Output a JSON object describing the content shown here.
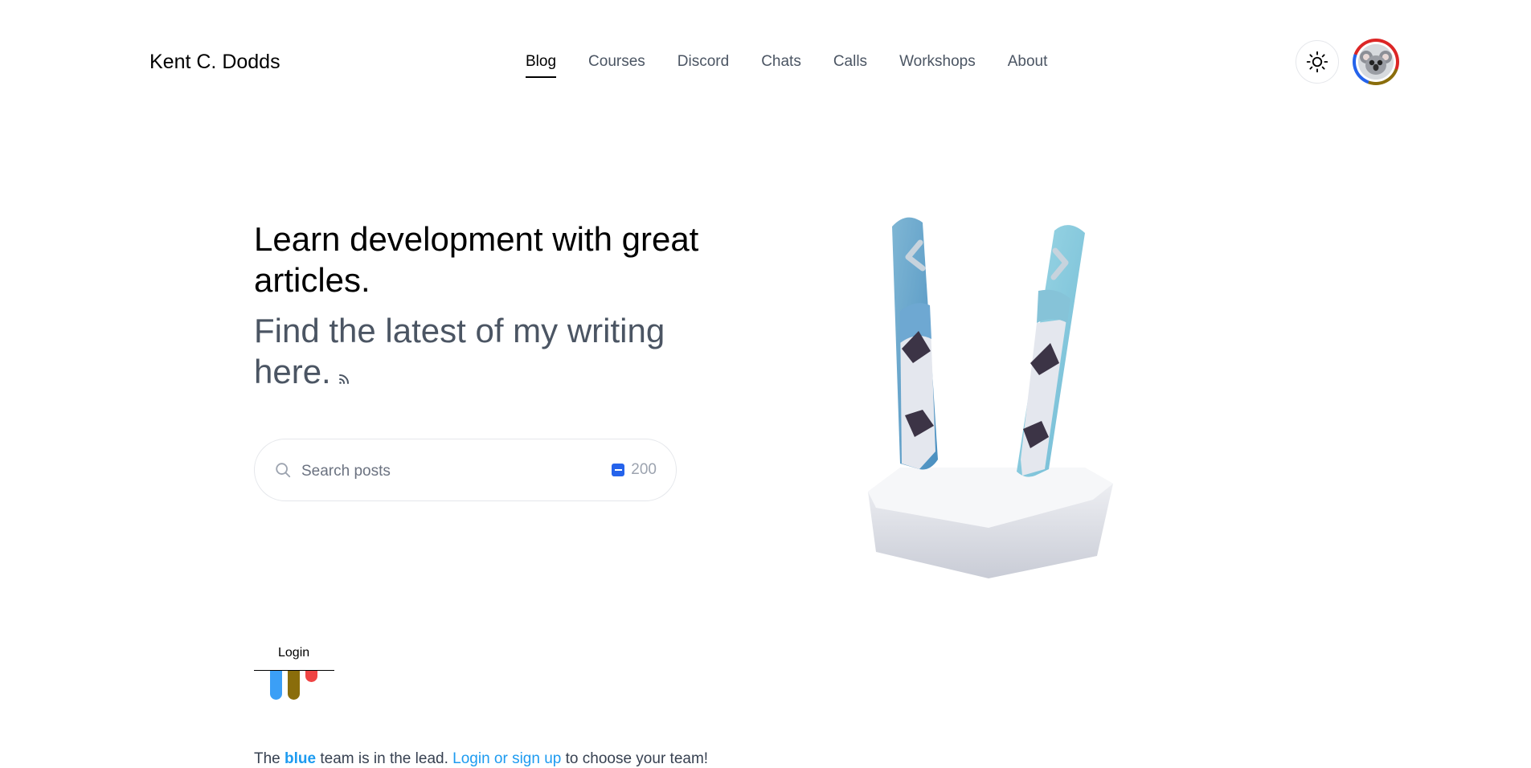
{
  "header": {
    "brand": "Kent C. Dodds",
    "nav": [
      {
        "label": "Blog",
        "active": true
      },
      {
        "label": "Courses"
      },
      {
        "label": "Discord"
      },
      {
        "label": "Chats"
      },
      {
        "label": "Calls"
      },
      {
        "label": "Workshops"
      },
      {
        "label": "About"
      }
    ],
    "theme_icon": "sun-icon",
    "avatar_icon": "koala-avatar"
  },
  "hero": {
    "title": "Learn development with great articles.",
    "subtitle": "Find the latest of my writing here.",
    "rss_icon": "rss-icon",
    "search": {
      "placeholder": "Search posts",
      "value": "",
      "post_count": "200",
      "search_icon": "search-icon"
    },
    "illustration": "skis-in-snow"
  },
  "team": {
    "login_label": "Login",
    "colors": {
      "blue": "#3b9ff6",
      "yellow": "#8a6d0b",
      "red": "#ef4444"
    },
    "footer": {
      "pre": "The ",
      "team_name": "blue",
      "mid": " team is in the lead. ",
      "link": "Login or sign up",
      "post": " to choose your team!"
    }
  }
}
